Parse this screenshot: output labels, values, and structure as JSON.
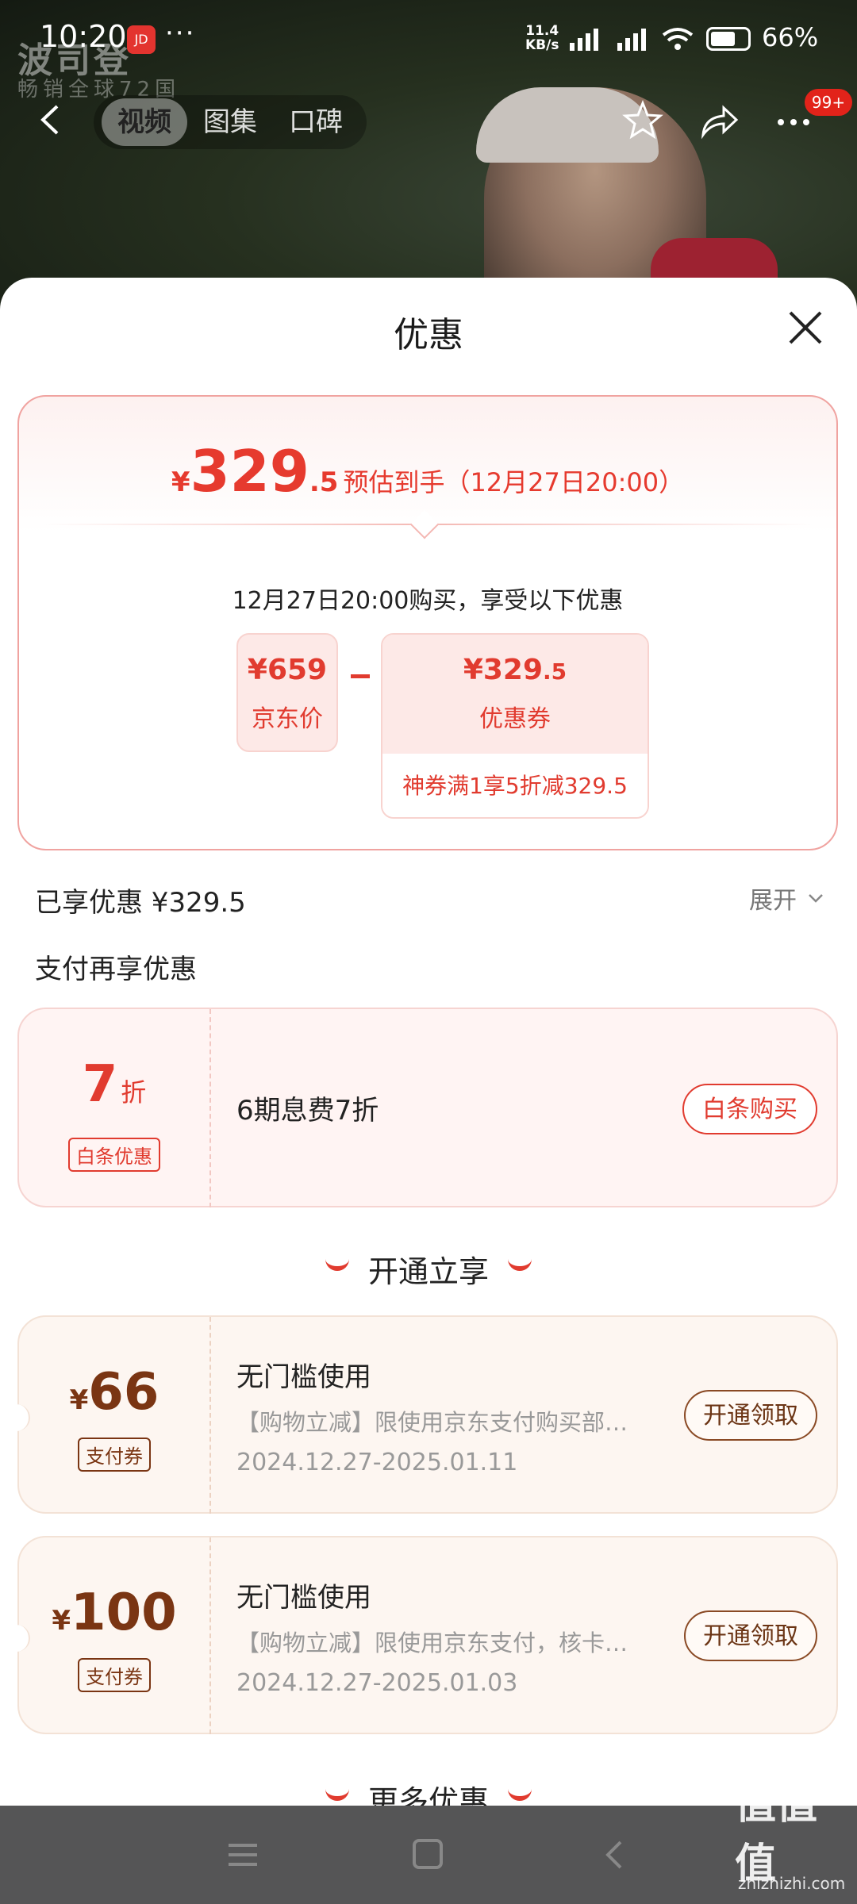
{
  "status_bar": {
    "time": "10:20",
    "net_speed_value": "11.4",
    "net_speed_unit": "KB/s",
    "battery": "66%"
  },
  "background": {
    "brand_text": "波司登",
    "brand_sub": "畅销全球72国"
  },
  "top_nav": {
    "tabs": [
      "视频",
      "图集",
      "口碑"
    ],
    "active_tab": 0,
    "badge": "99+"
  },
  "sheet": {
    "title": "优惠",
    "estimate": {
      "currency": "¥",
      "integer": "329",
      "decimal": ".5",
      "note": "预估到手（12月27日20:00）"
    },
    "purchase_text": "12月27日20:00购买，享受以下优惠",
    "jd_price": {
      "value": "¥659",
      "label": "京东价"
    },
    "coupon_box": {
      "value": "¥329",
      "decimal": ".5",
      "label": "优惠券",
      "desc": "神券满1享5折减329.5"
    },
    "enjoyed": "已享优惠 ¥329.5",
    "expand_label": "展开",
    "pay_section_title": "支付再享优惠",
    "baitiao": {
      "rate": "7",
      "rate_unit": "折",
      "tag": "白条优惠",
      "text": "6期息费7折",
      "button": "白条购买"
    },
    "kaitong_header": "开通立享",
    "coupons": [
      {
        "currency": "¥",
        "amount": "66",
        "tag": "支付券",
        "title": "无门槛使用",
        "desc": "【购物立减】限使用京东支付购买部…",
        "date": "2024.12.27-2025.01.11",
        "button": "开通领取"
      },
      {
        "currency": "¥",
        "amount": "100",
        "tag": "支付券",
        "title": "无门槛使用",
        "desc": "【购物立减】限使用京东支付，核卡…",
        "date": "2024.12.27-2025.01.03",
        "button": "开通领取"
      }
    ],
    "more_header": "更多优惠"
  },
  "watermark": {
    "text": "值值值",
    "sub": "zhizhizhi.com"
  },
  "colors": {
    "accent": "#e13b2f",
    "coupon_brown": "#7a3513"
  }
}
